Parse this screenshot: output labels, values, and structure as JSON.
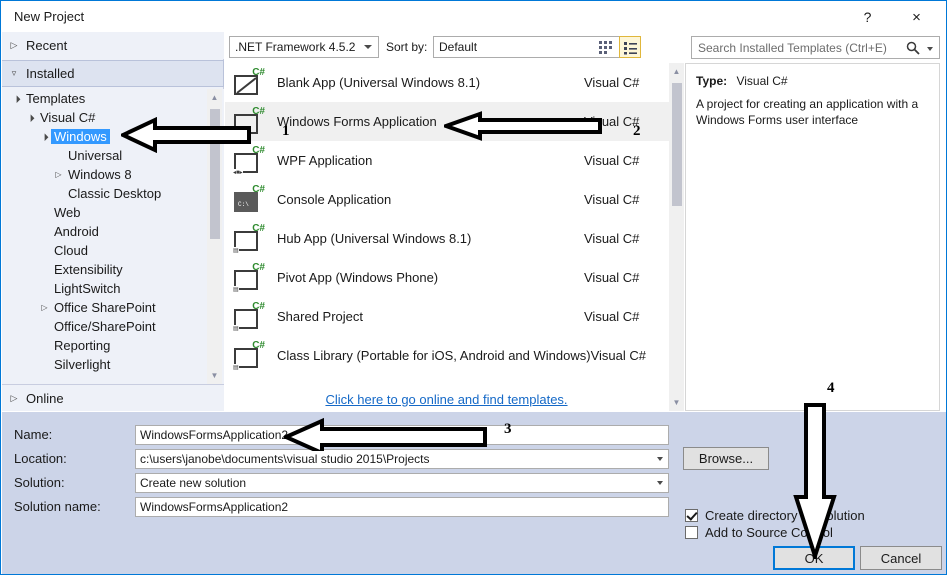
{
  "window": {
    "title": "New Project",
    "help_button": "?",
    "close_button": "×"
  },
  "toolbar": {
    "framework": ".NET Framework 4.5.2",
    "sort_by_label": "Sort by:",
    "sort_by_value": "Default",
    "view_grid_icon": "small-icons-view-icon",
    "view_list_icon": "list-view-icon"
  },
  "search": {
    "placeholder": "Search Installed Templates (Ctrl+E)",
    "icon": "search-icon"
  },
  "sidebar": {
    "recent": "Recent",
    "installed": "Installed",
    "online": "Online",
    "tree": [
      {
        "label": "Templates",
        "indent": 0,
        "twisty": "expanded",
        "selected": false
      },
      {
        "label": "Visual C#",
        "indent": 1,
        "twisty": "expanded",
        "selected": false
      },
      {
        "label": "Windows",
        "indent": 2,
        "twisty": "expanded",
        "selected": true
      },
      {
        "label": "Universal",
        "indent": 3,
        "twisty": "none",
        "selected": false
      },
      {
        "label": "Windows 8",
        "indent": 3,
        "twisty": "collapsed",
        "selected": false
      },
      {
        "label": "Classic Desktop",
        "indent": 3,
        "twisty": "none",
        "selected": false
      },
      {
        "label": "Web",
        "indent": 2,
        "twisty": "none",
        "selected": false
      },
      {
        "label": "Android",
        "indent": 2,
        "twisty": "none",
        "selected": false
      },
      {
        "label": "Cloud",
        "indent": 2,
        "twisty": "none",
        "selected": false
      },
      {
        "label": "Extensibility",
        "indent": 2,
        "twisty": "none",
        "selected": false
      },
      {
        "label": "LightSwitch",
        "indent": 2,
        "twisty": "none",
        "selected": false
      },
      {
        "label": "Office SharePoint",
        "indent": 2,
        "twisty": "collapsed",
        "selected": false
      },
      {
        "label": "Office/SharePoint",
        "indent": 2,
        "twisty": "none",
        "selected": false
      },
      {
        "label": "Reporting",
        "indent": 2,
        "twisty": "none",
        "selected": false
      },
      {
        "label": "Silverlight",
        "indent": 2,
        "twisty": "none",
        "selected": false
      }
    ]
  },
  "templates": {
    "items": [
      {
        "name": "Blank App (Universal Windows 8.1)",
        "lang": "Visual C#",
        "icon": "blank-app-icon",
        "selected": false
      },
      {
        "name": "Windows Forms Application",
        "lang": "Visual C#",
        "icon": "winforms-icon",
        "selected": true
      },
      {
        "name": "WPF Application",
        "lang": "Visual C#",
        "icon": "wpf-icon",
        "selected": false
      },
      {
        "name": "Console Application",
        "lang": "Visual C#",
        "icon": "console-icon",
        "selected": false
      },
      {
        "name": "Hub App (Universal Windows 8.1)",
        "lang": "Visual C#",
        "icon": "hub-app-icon",
        "selected": false
      },
      {
        "name": "Pivot App (Windows Phone)",
        "lang": "Visual C#",
        "icon": "pivot-app-icon",
        "selected": false
      },
      {
        "name": "Shared Project",
        "lang": "Visual C#",
        "icon": "shared-project-icon",
        "selected": false
      },
      {
        "name": "Class Library (Portable for iOS, Android and Windows)",
        "lang": "Visual C#",
        "icon": "class-library-icon",
        "selected": false
      }
    ],
    "online_link": "Click here to go online and find templates."
  },
  "description": {
    "type_label": "Type:",
    "type_value": "Visual C#",
    "text": "A project for creating an application with a Windows Forms user interface"
  },
  "form": {
    "name_label": "Name:",
    "name_value": "WindowsFormsApplication2",
    "location_label": "Location:",
    "location_value": "c:\\users\\janobe\\documents\\visual studio 2015\\Projects",
    "solution_label": "Solution:",
    "solution_value": "Create new solution",
    "solution_name_label": "Solution name:",
    "solution_name_value": "WindowsFormsApplication2",
    "browse_button": "Browse...",
    "create_directory_label": "Create directory for solution",
    "create_directory_checked": true,
    "add_source_control_label": "Add to Source Control",
    "add_source_control_checked": false,
    "ok_button": "OK",
    "cancel_button": "Cancel"
  },
  "annotations": {
    "numbers": [
      "1",
      "2",
      "3",
      "4"
    ],
    "arrow_1": "arrow-pointing-to-windows-tree-node",
    "arrow_2": "arrow-pointing-to-windows-forms-application",
    "arrow_3": "arrow-pointing-to-name-field",
    "arrow_4": "arrow-pointing-to-ok-button"
  },
  "colors": {
    "accent": "#0078d7",
    "selection": "#3399ff",
    "bottom_panel": "#ccd4e8",
    "sidebar": "#eef1f8",
    "link": "#1569c7",
    "csharp_green": "#2e8b2e"
  }
}
